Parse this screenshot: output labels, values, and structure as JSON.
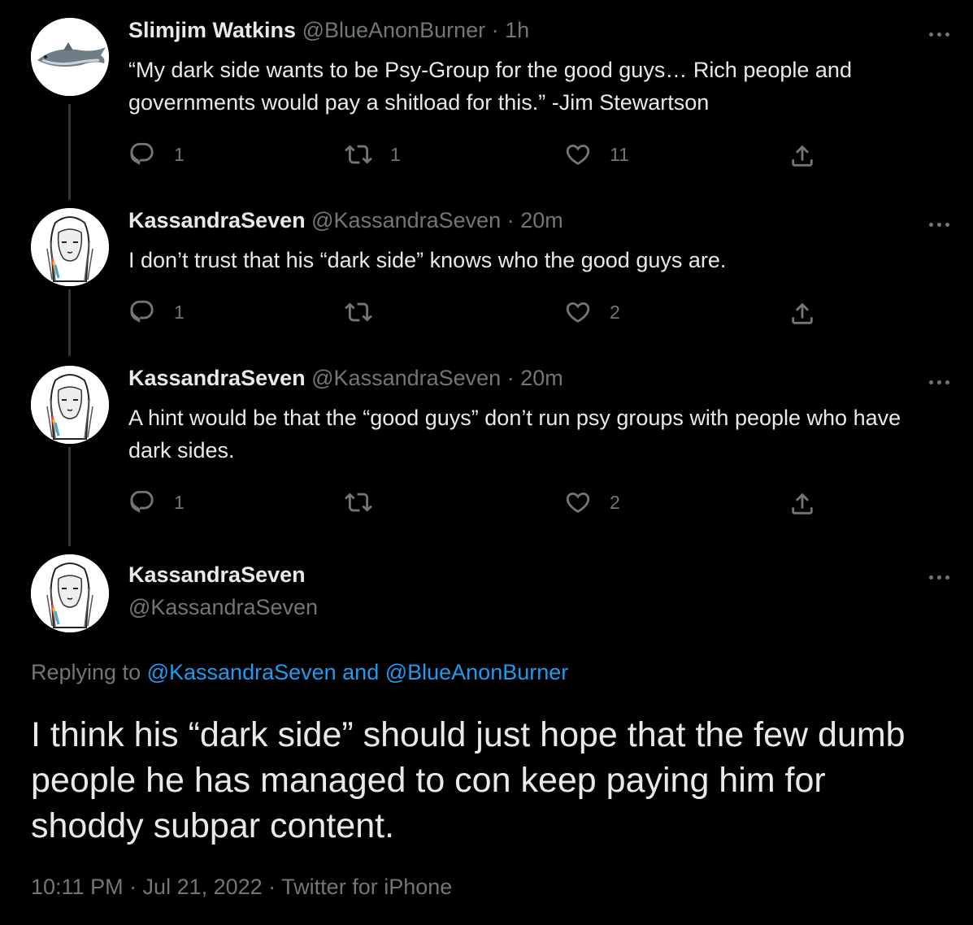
{
  "tweets": [
    {
      "name": "Slimjim Watkins",
      "handle": "@BlueAnonBurner",
      "time": "· 1h",
      "text": "“My dark side wants to be Psy-Group for the good guys… Rich people and governments would pay a shitload for this.” -Jim Stewartson",
      "replies": "1",
      "retweets": "1",
      "likes": "11",
      "avatar_icon": "fish-avatar"
    },
    {
      "name": "KassandraSeven",
      "handle": "@KassandraSeven",
      "time": "· 20m",
      "text": "I don’t trust that his “dark side” knows who the good guys are.",
      "replies": "1",
      "retweets": "",
      "likes": "2",
      "avatar_icon": "sketch-portrait-avatar"
    },
    {
      "name": "KassandraSeven",
      "handle": "@KassandraSeven",
      "time": "· 20m",
      "text": "A hint would be that the “good guys” don’t run psy groups with people who have dark sides.",
      "replies": "1",
      "retweets": "",
      "likes": "2",
      "avatar_icon": "sketch-portrait-avatar"
    }
  ],
  "main_tweet": {
    "name": "KassandraSeven",
    "handle": "@KassandraSeven",
    "replying_prefix": "Replying to",
    "replying_to": "@KassandraSeven and @BlueAnonBurner",
    "text": "I think his “dark side” should just hope that the few dumb people he has managed to con keep paying him for shoddy subpar content.",
    "timestamp": "10:11 PM · Jul 21, 2022 · Twitter for iPhone"
  },
  "colors": {
    "background": "#000000",
    "primary_text": "#e7e9ea",
    "secondary_text": "#71767b",
    "link": "#1d9bf0",
    "thread_line": "#333639"
  }
}
